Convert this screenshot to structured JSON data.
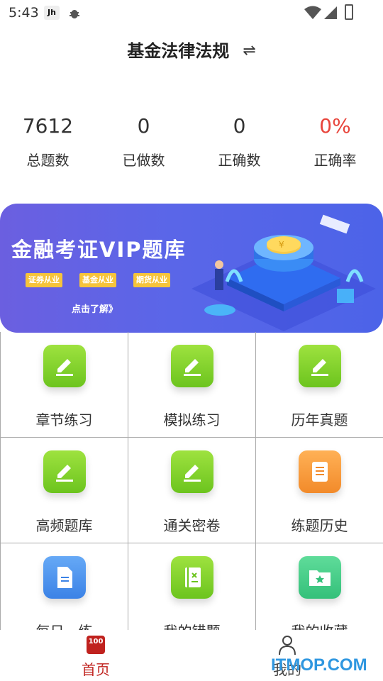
{
  "status_bar": {
    "time": "5:43",
    "app_icon_text": "Jh"
  },
  "header": {
    "title": "基金法律法规",
    "switch_icon": "⇌"
  },
  "stats": [
    {
      "value": "7612",
      "label": "总题数"
    },
    {
      "value": "0",
      "label": "已做数"
    },
    {
      "value": "0",
      "label": "正确数"
    },
    {
      "value": "0%",
      "label": "正确率"
    }
  ],
  "banner": {
    "title": "金融考证VIP题库",
    "tags": [
      "证券从业",
      "基金从业",
      "期货从业"
    ],
    "link": "点击了解》"
  },
  "grid": [
    {
      "label": "章节练习",
      "icon": "pencil-icon",
      "color": "green"
    },
    {
      "label": "模拟练习",
      "icon": "pencil-icon",
      "color": "green"
    },
    {
      "label": "历年真题",
      "icon": "pencil-icon",
      "color": "green"
    },
    {
      "label": "高频题库",
      "icon": "pencil-icon",
      "color": "green"
    },
    {
      "label": "通关密卷",
      "icon": "pencil-icon",
      "color": "green"
    },
    {
      "label": "练题历史",
      "icon": "scroll-icon",
      "color": "orange"
    },
    {
      "label": "每日一练",
      "icon": "document-icon",
      "color": "blue"
    },
    {
      "label": "我的错题",
      "icon": "notebook-icon",
      "color": "green"
    },
    {
      "label": "我的收藏",
      "icon": "folder-star-icon",
      "color": "teal"
    }
  ],
  "tabbar": {
    "home_icon_text": "100",
    "home_label": "首页",
    "me_label": "我的"
  },
  "watermark": "ITMOP.COM",
  "colors": {
    "accent_red": "#c0221e",
    "rate_red": "#e8453c",
    "banner_blue": "#5a66e8",
    "tag_yellow": "#f6c43b"
  }
}
